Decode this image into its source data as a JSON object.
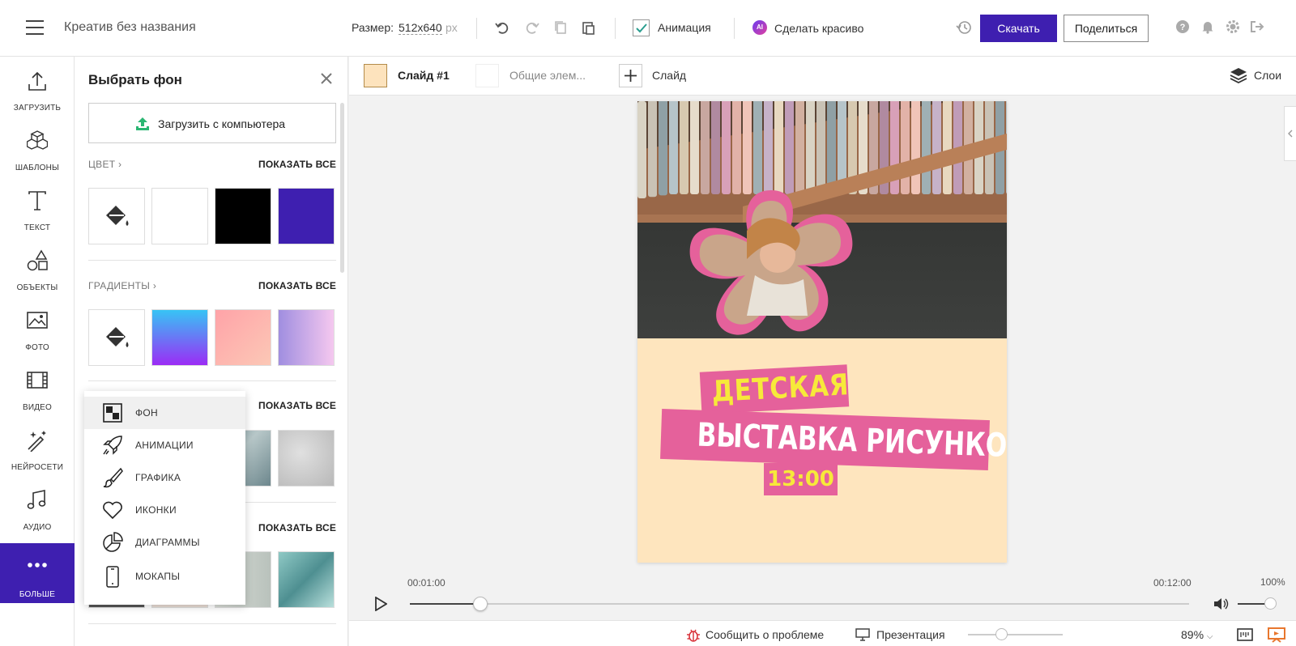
{
  "header": {
    "doc_title": "Креатив без названия",
    "size_label": "Размер:",
    "size_value": "512x640",
    "size_unit": "px",
    "animation_label": "Анимация",
    "animation_checked": true,
    "ai_badge": "AI",
    "ai_label": "Сделать красиво",
    "download_label": "Скачать",
    "share_label": "Поделиться",
    "accent_color": "#3e1fb0"
  },
  "nav": {
    "items": [
      {
        "label": "ЗАГРУЗИТЬ",
        "icon": "upload-icon"
      },
      {
        "label": "ШАБЛОНЫ",
        "icon": "templates-icon"
      },
      {
        "label": "ТЕКСТ",
        "icon": "text-icon"
      },
      {
        "label": "ОБЪЕКТЫ",
        "icon": "shapes-icon"
      },
      {
        "label": "ФОТО",
        "icon": "photo-icon"
      },
      {
        "label": "ВИДЕО",
        "icon": "video-icon"
      },
      {
        "label": "НЕЙРОСЕТИ",
        "icon": "magic-wand-icon"
      },
      {
        "label": "АУДИО",
        "icon": "music-icon"
      },
      {
        "label": "БОЛЬШЕ",
        "icon": "more-icon"
      }
    ]
  },
  "panel": {
    "title": "Выбрать фон",
    "upload_label": "Загрузить с компьютера",
    "color_section": "ЦВЕТ",
    "gradient_section": "ГРАДИЕНТЫ",
    "show_all": "ПОКАЗАТЬ ВСЕ",
    "colors": [
      "#ffffff",
      "#000000",
      "#3e1fb0"
    ],
    "gradients": [
      "linear-gradient(180deg,#37c4f5,#9b2cf5)",
      "linear-gradient(135deg,#ffa3a8,#fcc8b6)",
      "linear-gradient(90deg,#a08ee0,#f5c8ef)"
    ]
  },
  "more_menu": {
    "items": [
      {
        "label": "ФОН",
        "icon": "background-icon"
      },
      {
        "label": "АНИМАЦИИ",
        "icon": "rocket-icon"
      },
      {
        "label": "ГРАФИКА",
        "icon": "brush-icon"
      },
      {
        "label": "ИКОНКИ",
        "icon": "heart-icon"
      },
      {
        "label": "ДИАГРАММЫ",
        "icon": "pie-chart-icon"
      },
      {
        "label": "МОКАПЫ",
        "icon": "phone-icon"
      }
    ]
  },
  "slides": {
    "slide_label": "Слайд #1",
    "common_label": "Общие элем...",
    "add_label": "Слайд",
    "layers_label": "Слои"
  },
  "canvas": {
    "line1": "ДЕТСКАЯ",
    "line2": "ВЫСТАВКА РИСУНКОВ",
    "line3": "13:00",
    "bg_color": "#fee5be",
    "banner_color": "#e5619b"
  },
  "timeline": {
    "current_time": "00:01:00",
    "end_time": "00:12:00",
    "progress": 0.09,
    "volume_label": "100%"
  },
  "footer": {
    "report_label": "Сообщить о проблеме",
    "presentation_label": "Презентация",
    "zoom_value": "89%",
    "zoom_level": 0.3
  }
}
